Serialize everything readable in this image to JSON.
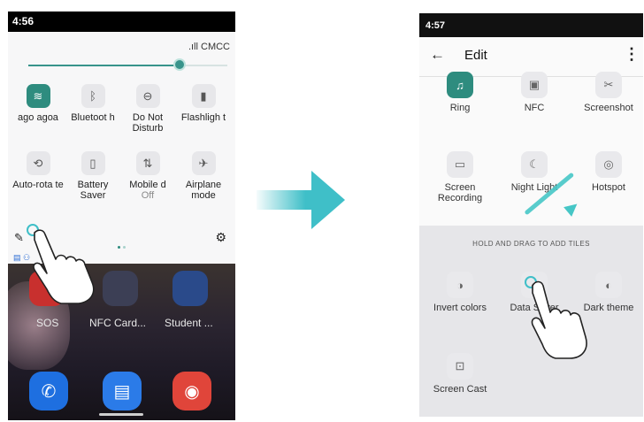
{
  "left_phone": {
    "time": "4:56",
    "carrier": ".ıll CMCC",
    "brightness_level": 0.76,
    "tiles_row1": [
      {
        "label": "ago agoa",
        "icon": "wifi-icon",
        "glyph": "≋",
        "active": true
      },
      {
        "label": "Bluetoot h",
        "icon": "bluetooth-icon",
        "glyph": "ᛒ",
        "active": false
      },
      {
        "label": "Do Not Disturb",
        "icon": "do-not-disturb-icon",
        "glyph": "⊖",
        "active": false
      },
      {
        "label": "Flashligh t",
        "icon": "flashlight-icon",
        "glyph": "▮",
        "active": false
      }
    ],
    "tiles_row2": [
      {
        "label": "Auto-rota te",
        "sub": "",
        "icon": "auto-rotate-icon",
        "glyph": "⟲",
        "active": false
      },
      {
        "label": "Battery Saver",
        "sub": "",
        "icon": "battery-saver-icon",
        "glyph": "▯",
        "active": false
      },
      {
        "label": "Mobile d",
        "sub": "Off",
        "icon": "mobile-data-icon",
        "glyph": "⇅",
        "active": false
      },
      {
        "label": "Airplane mode",
        "sub": "",
        "icon": "airplane-icon",
        "glyph": "✈",
        "active": false
      }
    ],
    "apps": [
      {
        "label": "SOS"
      },
      {
        "label": "NFC Card..."
      },
      {
        "label": "Student ..."
      }
    ],
    "dock": [
      {
        "icon": "phone-icon",
        "glyph": "✆",
        "color": "#1e6fe0"
      },
      {
        "icon": "messages-icon",
        "glyph": "▤",
        "color": "#2b7be8"
      },
      {
        "icon": "chrome-icon",
        "glyph": "◉",
        "color": "#e0453a"
      }
    ]
  },
  "right_phone": {
    "time": "4:57",
    "title": "Edit",
    "active_tiles": [
      {
        "label": "Ring",
        "icon": "bell-icon",
        "glyph": "♫",
        "active": true
      },
      {
        "label": "NFC",
        "icon": "nfc-icon",
        "glyph": "▣",
        "active": false
      },
      {
        "label": "Screenshot",
        "icon": "screenshot-icon",
        "glyph": "✂",
        "active": false
      },
      {
        "label": "Screen Recording",
        "icon": "screen-recording-icon",
        "glyph": "▭",
        "active": false
      },
      {
        "label": "Night Light",
        "icon": "night-light-icon",
        "glyph": "☾",
        "active": false
      },
      {
        "label": "Hotspot",
        "icon": "hotspot-icon",
        "glyph": "◎",
        "active": false
      }
    ],
    "hold_text": "HOLD AND DRAG TO ADD TILES",
    "inactive_tiles": [
      {
        "label": "Invert colors",
        "icon": "invert-colors-icon",
        "glyph": "◑"
      },
      {
        "label": "Data Saver",
        "icon": "data-saver-icon",
        "glyph": "◌"
      },
      {
        "label": "Dark theme",
        "icon": "dark-theme-icon",
        "glyph": "◐"
      },
      {
        "label": "Screen Cast",
        "icon": "screen-cast-icon",
        "glyph": "⊡"
      }
    ]
  },
  "colors": {
    "accent": "#2e8c7f",
    "arrow": "#3fbfc8",
    "tip": "#46c6c6"
  }
}
